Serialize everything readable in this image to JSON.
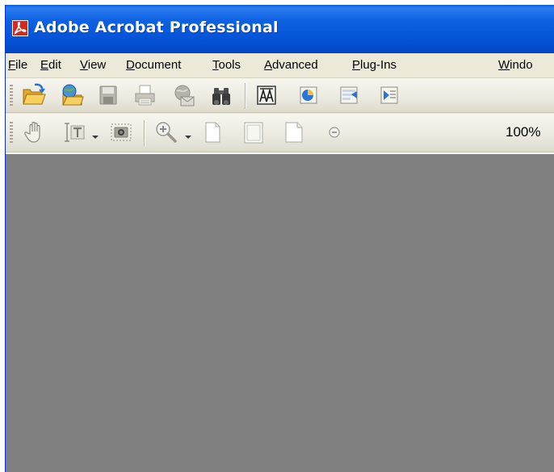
{
  "window": {
    "title": "Adobe Acrobat Professional",
    "accent_color": "#0553d8"
  },
  "menu": {
    "items": [
      {
        "pre": "",
        "key": "F",
        "post": "ile"
      },
      {
        "pre": "",
        "key": "E",
        "post": "dit"
      },
      {
        "pre": "",
        "key": "V",
        "post": "iew"
      },
      {
        "pre": "",
        "key": "D",
        "post": "ocument"
      },
      {
        "pre": "",
        "key": "T",
        "post": "ools"
      },
      {
        "pre": "",
        "key": "A",
        "post": "dvanced"
      },
      {
        "pre": "",
        "key": "P",
        "post": "lug-Ins"
      },
      {
        "pre": "",
        "key": "W",
        "post": "indo"
      }
    ]
  },
  "toolbar1": {
    "buttons": [
      "open-folder-icon",
      "organizer-icon",
      "save-icon",
      "print-icon",
      "email-icon",
      "search-binoculars-icon",
      "create-pdf-icon",
      "review-icon",
      "forms-icon",
      "export-icon"
    ]
  },
  "toolbar2": {
    "buttons": [
      "hand-tool-icon",
      "select-text-icon",
      "snapshot-icon",
      "zoom-in-icon",
      "actual-size-icon",
      "fit-page-icon",
      "fit-width-icon",
      "zoom-out-icon"
    ],
    "zoom_value": "100%"
  },
  "document": {
    "background": "#808080"
  }
}
